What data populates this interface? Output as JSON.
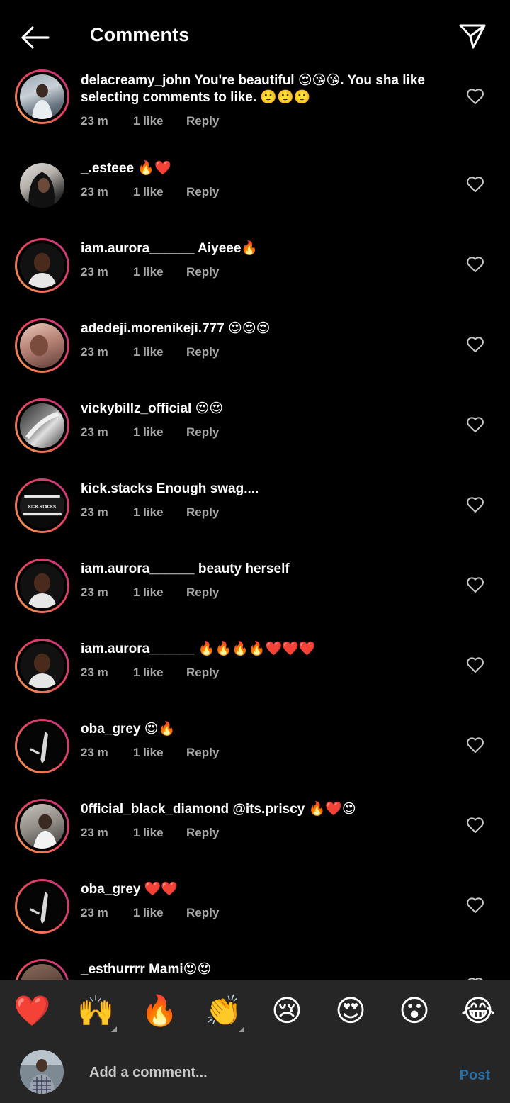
{
  "header": {
    "title": "Comments"
  },
  "comments": [
    {
      "username": "delacreamy_john",
      "text": "You're beautiful 😍😘😘. You sha like selecting comments to like. 🙂🙂🙂",
      "time": "23 m",
      "likes": "1 like",
      "reply": "Reply"
    },
    {
      "username": "_.esteee",
      "text": "🔥❤️",
      "time": "23 m",
      "likes": "1 like",
      "reply": "Reply"
    },
    {
      "username": "iam.aurora______",
      "text": "Aiyeee🔥",
      "time": "23 m",
      "likes": "1 like",
      "reply": "Reply"
    },
    {
      "username": "adedeji.morenikeji.777",
      "text": "😍😍😍",
      "time": "23 m",
      "likes": "1 like",
      "reply": "Reply"
    },
    {
      "username": "vickybillz_official",
      "text": "😍😍",
      "time": "23 m",
      "likes": "1 like",
      "reply": "Reply"
    },
    {
      "username": "kick.stacks",
      "text": "Enough swag....",
      "time": "23 m",
      "likes": "1 like",
      "reply": "Reply"
    },
    {
      "username": "iam.aurora______",
      "text": "beauty herself",
      "time": "23 m",
      "likes": "1 like",
      "reply": "Reply"
    },
    {
      "username": "iam.aurora______",
      "text": "🔥🔥🔥🔥❤️❤️❤️",
      "time": "23 m",
      "likes": "1 like",
      "reply": "Reply"
    },
    {
      "username": "oba_grey",
      "text": "😍🔥",
      "time": "23 m",
      "likes": "1 like",
      "reply": "Reply"
    },
    {
      "username": "0fficial_black_diamond",
      "text": "@its.priscy 🔥❤️😍",
      "time": "23 m",
      "likes": "1 like",
      "reply": "Reply"
    },
    {
      "username": "oba_grey",
      "text": "❤️❤️",
      "time": "23 m",
      "likes": "1 like",
      "reply": "Reply"
    },
    {
      "username": "_esthurrrr",
      "text": "Mami😍😍",
      "time": "",
      "likes": "",
      "reply": ""
    }
  ],
  "reactions": [
    "❤️",
    "🙌",
    "🔥",
    "👏",
    "😢",
    "😍",
    "😮",
    "😂"
  ],
  "compose": {
    "placeholder": "Add a comment...",
    "post_label": "Post"
  },
  "avatar_logo_text": "KICK.STACKS",
  "colors": {
    "background": "#000000",
    "bar": "#262626",
    "muted_text": "#a8a8a8",
    "post_disabled": "#2a6fa6"
  }
}
